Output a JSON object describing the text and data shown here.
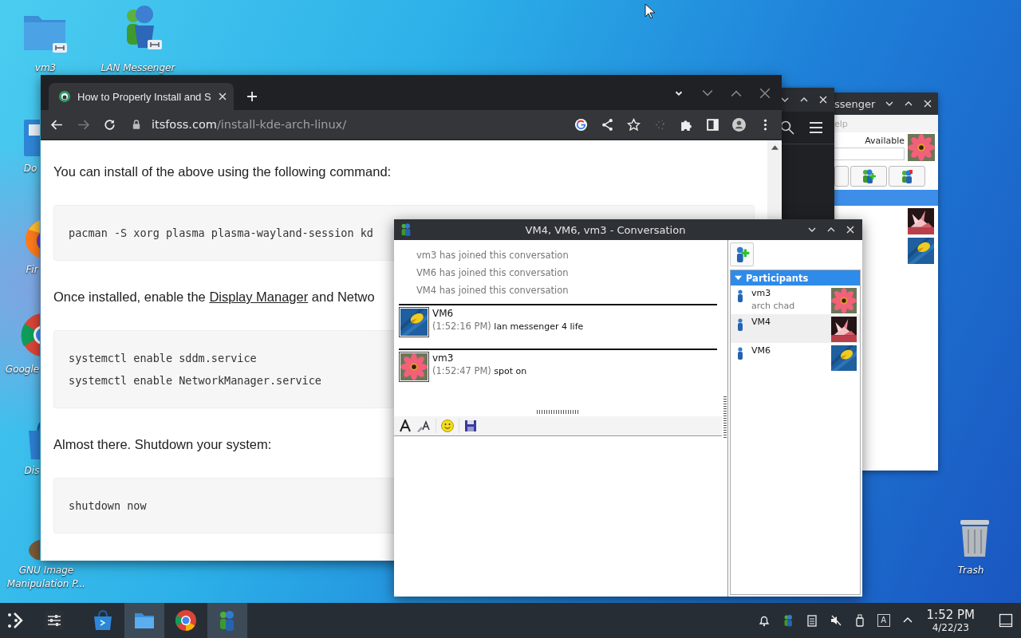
{
  "desktop": {
    "icons": [
      {
        "kind": "folder",
        "label": "vm3",
        "linked": true
      },
      {
        "kind": "messenger",
        "label": "LAN Messenger",
        "linked": true
      },
      {
        "kind": "documents",
        "label": "Do"
      },
      {
        "kind": "firefox",
        "label": "Fir"
      },
      {
        "kind": "chrome",
        "label": "Google"
      },
      {
        "kind": "discover",
        "label": "Dis"
      },
      {
        "kind": "paint",
        "label": "GNU Image Manipulation P..."
      },
      {
        "kind": "trash",
        "label": "Trash"
      }
    ]
  },
  "messenger_main": {
    "title": "ssenger",
    "menu": [
      "elp"
    ],
    "status": "Available",
    "rows": [
      {
        "kind": "group",
        "selected": true
      },
      {
        "kind": "contact"
      },
      {
        "kind": "contact"
      }
    ]
  },
  "browser": {
    "tab": {
      "title": "How to Properly Install and S",
      "selected": true
    },
    "can_go_forward": false,
    "url": {
      "host": "itsfoss.com",
      "path": "/install-kde-arch-linux/"
    },
    "content": [
      {
        "kind": "paragraph",
        "parts": [
          {
            "text": "You can install of the above using the following command:",
            "link": false
          }
        ]
      },
      {
        "kind": "code",
        "lines": [
          "pacman -S xorg plasma plasma-wayland-session kd"
        ]
      },
      {
        "kind": "paragraph",
        "parts": [
          {
            "text": "Once installed, enable the ",
            "link": false
          },
          {
            "text": "Display Manager",
            "link": true
          },
          {
            "text": " and Netwo",
            "link": false
          }
        ]
      },
      {
        "kind": "code",
        "lines": [
          "systemctl enable sddm.service",
          "systemctl enable NetworkManager.service"
        ]
      },
      {
        "kind": "paragraph",
        "parts": [
          {
            "text": "Almost there. Shutdown your system:",
            "link": false
          }
        ]
      },
      {
        "kind": "code",
        "lines": [
          "shutdown now"
        ]
      }
    ]
  },
  "conversation": {
    "title": "VM4, VM6, vm3 - Conversation",
    "events": [
      "vm3 has joined this conversation",
      "VM6 has joined this conversation",
      "VM4 has joined this conversation"
    ],
    "messages": [
      {
        "sender": "VM6",
        "time": "(1:52:16 PM)",
        "text": "lan messenger 4 life"
      },
      {
        "sender": "vm3",
        "time": "(1:52:47 PM)",
        "text": "spot on"
      }
    ],
    "participants": {
      "label": "Participants",
      "expanded": true,
      "items": [
        {
          "name": "vm3",
          "note": "arch chad",
          "highlighted": false
        },
        {
          "name": "VM4",
          "highlighted": true
        },
        {
          "name": "VM6",
          "highlighted": false
        }
      ]
    }
  },
  "taskbar": {
    "tasks": [
      {
        "kind": "store",
        "active": false
      },
      {
        "kind": "folder",
        "active": true
      },
      {
        "kind": "chrome",
        "active": false
      },
      {
        "kind": "messenger",
        "active": true
      }
    ],
    "tray": [
      {
        "kind": "bell"
      },
      {
        "kind": "messenger"
      },
      {
        "kind": "clipboard"
      },
      {
        "kind": "muted"
      },
      {
        "kind": "usb"
      },
      {
        "kind": "input",
        "glyph": "A"
      },
      {
        "kind": "expand"
      }
    ],
    "clock": {
      "time": "1:52 PM",
      "date": "4/22/23"
    }
  }
}
